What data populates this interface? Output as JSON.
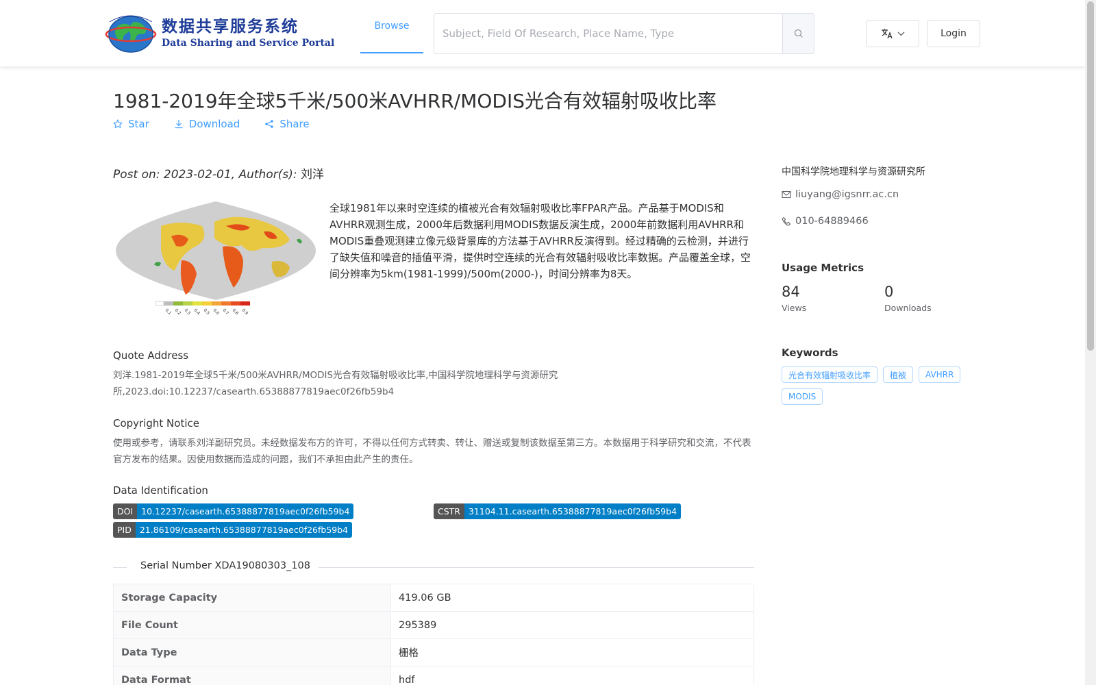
{
  "header": {
    "logo_cn": "数据共享服务系统",
    "logo_en": "Data Sharing and Service Portal",
    "nav_browse": "Browse",
    "search_placeholder": "Subject, Field Of Research, Place Name, Type",
    "login": "Login"
  },
  "dataset": {
    "title": "1981-2019年全球5千米/500米AVHRR/MODIS光合有效辐射吸收比率",
    "actions": {
      "star": "Star",
      "download": "Download",
      "share": "Share"
    },
    "post_prefix": "Post on: 2023-02-01, Author(s):",
    "author": "刘洋",
    "description": "全球1981年以来时空连续的植被光合有效辐射吸收比率FPAR产品。产品基于MODIS和AVHRR观测生成，2000年后数据利用MODIS数据反演生成，2000年前数据利用AVHRR和MODIS重叠观测建立像元级背景库的方法基于AVHRR反演得到。经过精确的云检测，并进行了缺失值和噪音的插值平滑，提供时空连续的光合有效辐射吸收比率数据。产品覆盖全球，空间分辨率为5km(1981-1999)/500m(2000-)，时间分辨率为8天。",
    "legend_ticks": [
      "0.1",
      "0.2",
      "0.3",
      "0.4",
      "0.5",
      "0.6",
      "0.7",
      "0.8",
      "0.9"
    ],
    "quote_label": "Quote Address",
    "quote_text": "刘洋.1981-2019年全球5千米/500米AVHRR/MODIS光合有效辐射吸收比率,中国科学院地理科学与资源研究所,2023.doi:10.12237/casearth.65388877819aec0f26fb59b4",
    "copyright_label": "Copyright Notice",
    "copyright_text": "使用或参考，请联系刘洋副研究员。未经数据发布方的许可，不得以任何方式转卖、转让、赠送或复制该数据至第三方。本数据用于科学研究和交流，不代表官方发布的结果。因使用数据而造成的问题，我们不承担由此产生的责任。",
    "ident_label": "Data Identification",
    "doi_key": "DOI",
    "doi_val": "10.12237/casearth.65388877819aec0f26fb59b4",
    "cstr_key": "CSTR",
    "cstr_val": "31104.11.casearth.65388877819aec0f26fb59b4",
    "pid_key": "PID",
    "pid_val": "21.86109/casearth.65388877819aec0f26fb59b4",
    "serial": "Serial Number XDA19080303_108",
    "info_rows": [
      {
        "key": "Storage Capacity",
        "value": "419.06 GB"
      },
      {
        "key": "File Count",
        "value": "295389"
      },
      {
        "key": "Data Type",
        "value": "栅格"
      },
      {
        "key": "Data Format",
        "value": "hdf"
      }
    ]
  },
  "sidebar": {
    "org": "中国科学院地理科学与资源研究所",
    "email": "liuyang@igsnrr.ac.cn",
    "phone": "010-64889466",
    "metrics_heading": "Usage Metrics",
    "views_num": "84",
    "views_label": "Views",
    "downloads_num": "0",
    "downloads_label": "Downloads",
    "keywords_heading": "Keywords",
    "keywords": [
      "光合有效辐射吸收比率",
      "植被",
      "AVHRR",
      "MODIS"
    ]
  },
  "colors": {
    "accent": "#409eff",
    "badge_key": "#555555",
    "badge_value": "#007ec6",
    "logo_blue": "#1f3d99"
  }
}
